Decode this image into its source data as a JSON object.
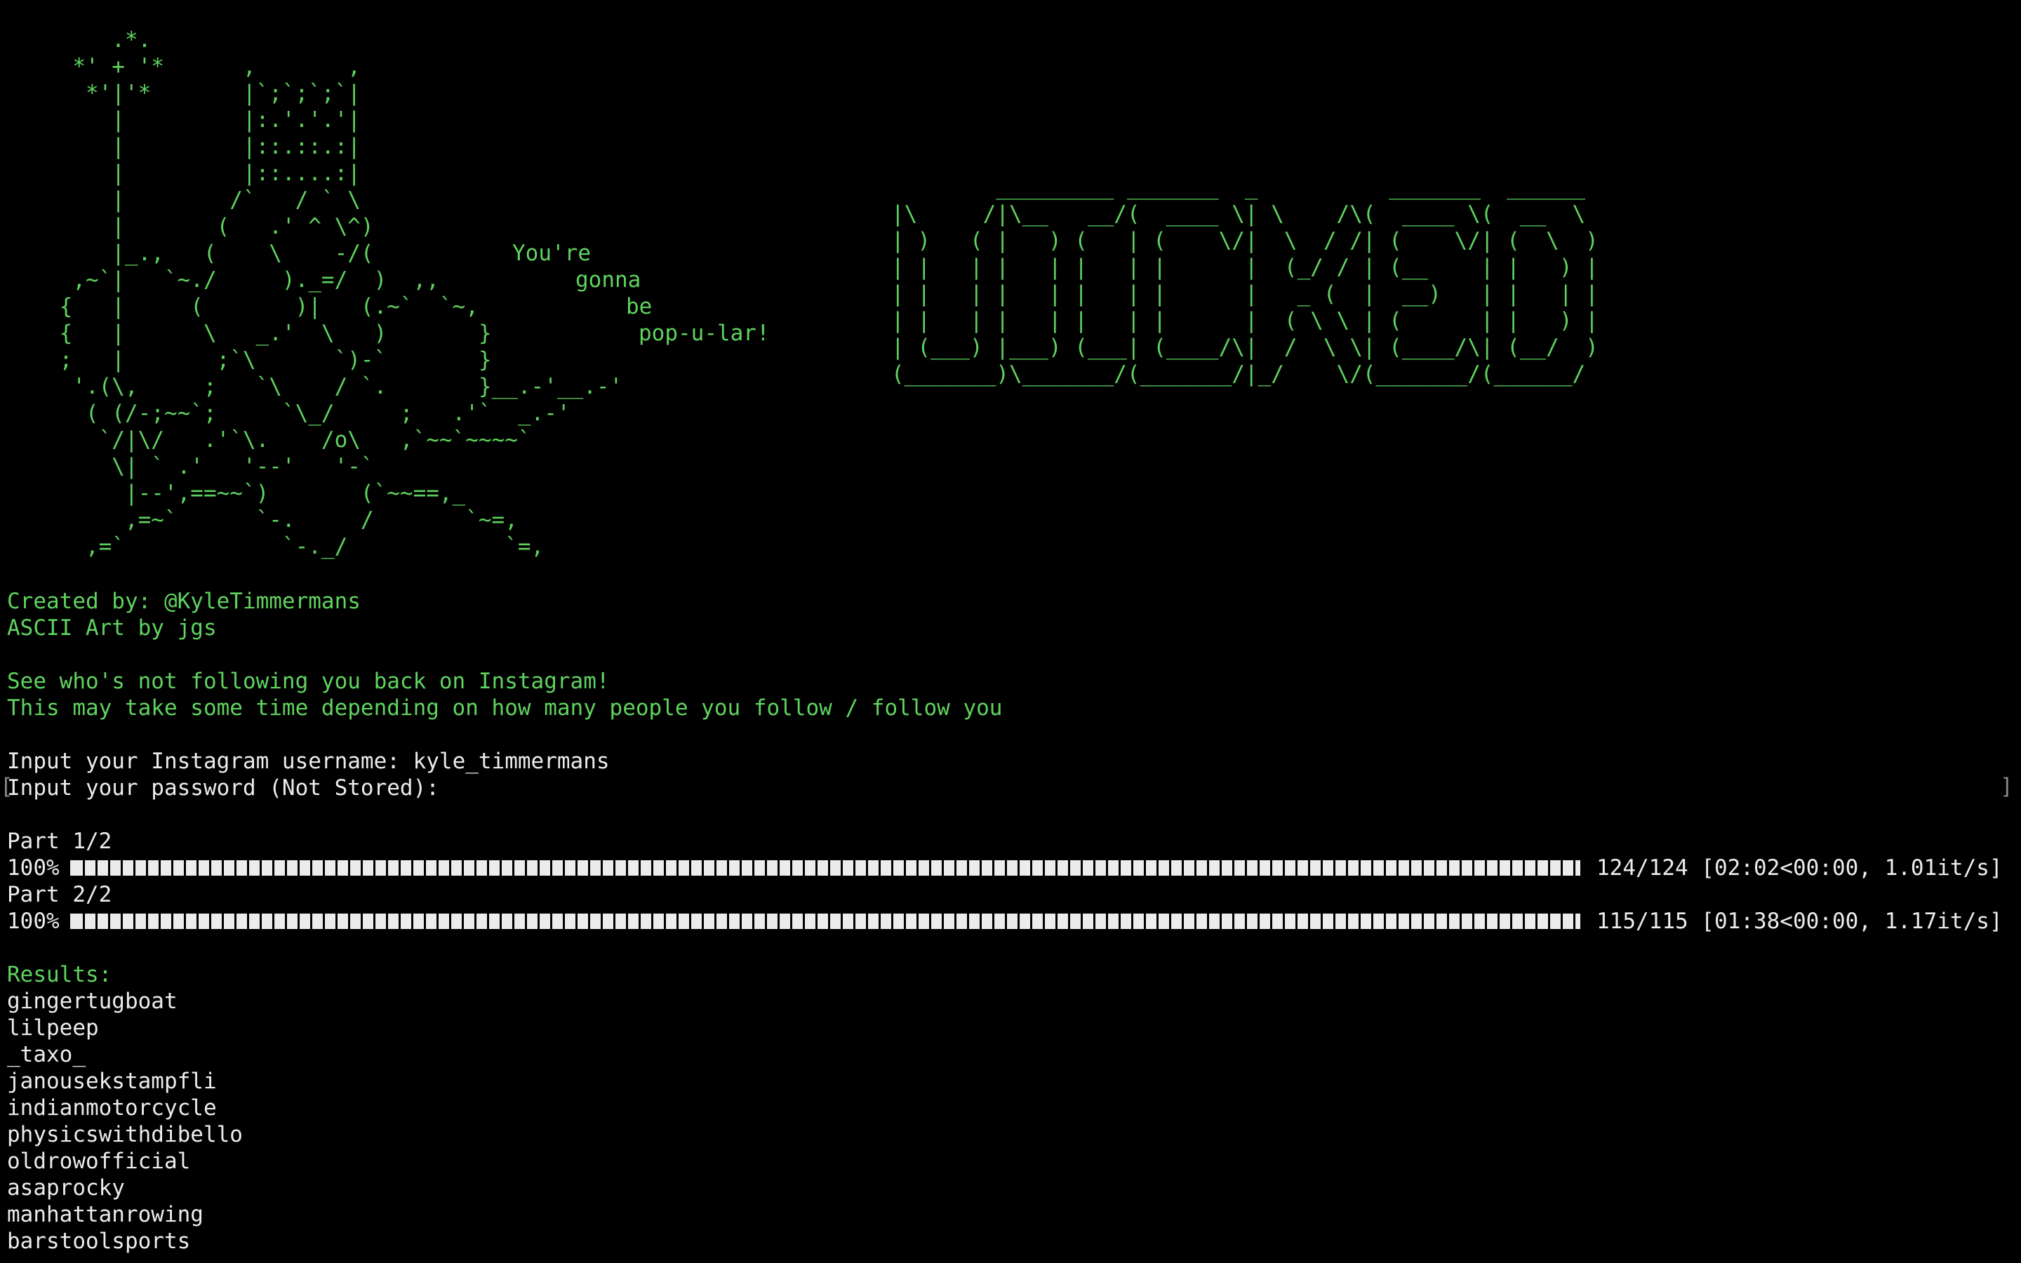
{
  "ascii_art": "        .*.\n     *' + '*      ,       ,\n      *'|'*       |`;`;`;`|\n        |         |:.'.'.'|\n        |         |::.::.:|\n        |         |::....:|\n        |        /`   / ` \\\n        |       (   .' ^ \\^)\n        |_.,   (    \\    -/(\n     ,~`|   `~./     )._=/  )  ,,\n    {   |     (       )|   (.~`  `~,\n    {   |      \\   _.'  \\   )       }\n    ;   |       ;`\\      `)-`       }\n     '.(\\,     ;   `\\    / `.       }__.-'__.-'\n      ( (/-;~~`;     `\\_/     ;   .'`  _.-'\n       `/|\\/   .'`\\.    /o\\   ,`~~`~~~~`\n        \\| ` .'   '--'   '-`\n         |--',==~~`)       (`~~==,_\n         ,=~`      `-.     /       `~=,\n      ,=`            `-._/            `=,",
  "tagline": [
    "You're",
    "gonna",
    "be",
    "pop-u-lar!"
  ],
  "logo": "        _________ _______  _          _______  ______\n|\\     /|\\__   __/(  ____ \\| \\    /\\(  ____ \\(  __  \\\n| )   ( |   ) (   | (    \\/|  \\  / /| (    \\/| (  \\  )\n| |   | |   | |   | |      |  (_/ / | (__    | |   ) |\n| |   | |   | |   | |      |   _ (  |  __)   | |   | |\n| |   | |   | |   | |      |  ( \\ \\ | (      | |   ) |\n| (___) |___) (___| (____/\\|  /  \\ \\| (____/\\| (__/  )\n(_______)\\_______/(_______/|_/    \\/(_______/(______/",
  "credits": {
    "created_by": "Created by: @KyleTimmermans",
    "ascii_by": "ASCII Art by jgs"
  },
  "intro": {
    "line1": "See who's not following you back on Instagram!",
    "line2": "This may take some time depending on how many people you follow / follow you"
  },
  "prompts": {
    "username_prompt": "Input your Instagram username: ",
    "username_value": "kyle_timmermans",
    "password_prompt": "Input your password (Not Stored):"
  },
  "progress": [
    {
      "label": "Part 1/2",
      "percent": "100%",
      "fraction": 1.0,
      "stats": "124/124 [02:02<00:00,  1.01it/s]"
    },
    {
      "label": "Part 2/2",
      "percent": "100%",
      "fraction": 1.0,
      "stats": "115/115 [01:38<00:00,  1.17it/s]"
    }
  ],
  "results": {
    "heading": "Results:",
    "items": [
      "gingertugboat",
      "lilpeep",
      "_taxo_",
      "janousekstampfli",
      "indianmotorcycle",
      "physicswithdibello",
      "oldrowofficial",
      "asaprocky",
      "manhattanrowing",
      "barstoolsports"
    ]
  },
  "colors": {
    "background": "#000000",
    "green": "#5fd35f",
    "white": "#ececec"
  }
}
